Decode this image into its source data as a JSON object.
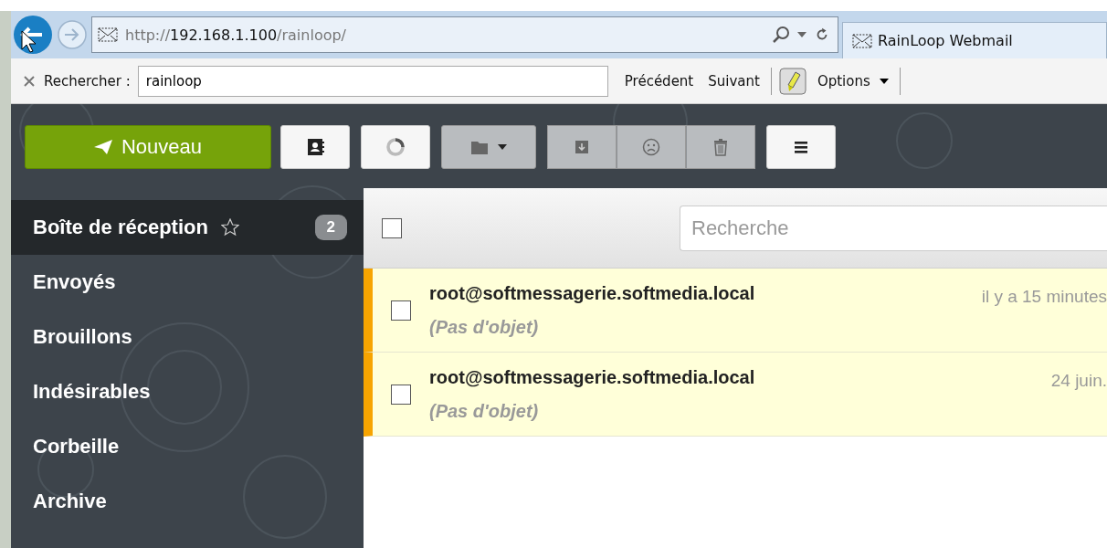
{
  "browser": {
    "address": {
      "scheme": "http://",
      "host": "192.168.1.100",
      "path": "/rainloop/"
    },
    "tab": {
      "title": "RainLoop Webmail",
      "selected": true
    },
    "find_bar": {
      "label": "Rechercher :",
      "value": "rainloop",
      "buttons": [
        "Précédent",
        "Suivant"
      ],
      "options": "Options"
    }
  },
  "toolbar": {
    "new_button": "Nouveau",
    "buttons": [
      {
        "kind": "contacts",
        "disabled": false
      },
      {
        "kind": "refresh",
        "disabled": false
      },
      {
        "kind": "folder",
        "disabled": true
      },
      {
        "kind": "archive",
        "disabled": true,
        "group": true
      },
      {
        "kind": "spam",
        "disabled": true,
        "group": true
      },
      {
        "kind": "delete",
        "disabled": true,
        "group": true
      },
      {
        "kind": "menu",
        "disabled": false
      }
    ]
  },
  "sidebar": {
    "folders": [
      {
        "name": "Boîte de réception",
        "selected": true,
        "starred": false,
        "count": "2"
      },
      {
        "name": "Envoyés",
        "selected": false
      },
      {
        "name": "Brouillons",
        "selected": false
      },
      {
        "name": "Indésirables",
        "selected": false
      },
      {
        "name": "Corbeille",
        "selected": false
      },
      {
        "name": "Archive",
        "selected": false
      }
    ]
  },
  "message_list": {
    "select_all": {
      "checked": false
    },
    "search": {
      "placeholder": "Recherche"
    },
    "messages": [
      {
        "from": "root@softmessagerie.softmedia.local",
        "subject": "(Pas d'objet)",
        "date": "il y a 15 minutes",
        "unread": true,
        "checked": false
      },
      {
        "from": "root@softmessagerie.softmedia.local",
        "subject": "(Pas d'objet)",
        "date": "24 juin.",
        "unread": true,
        "checked": false
      }
    ]
  }
}
